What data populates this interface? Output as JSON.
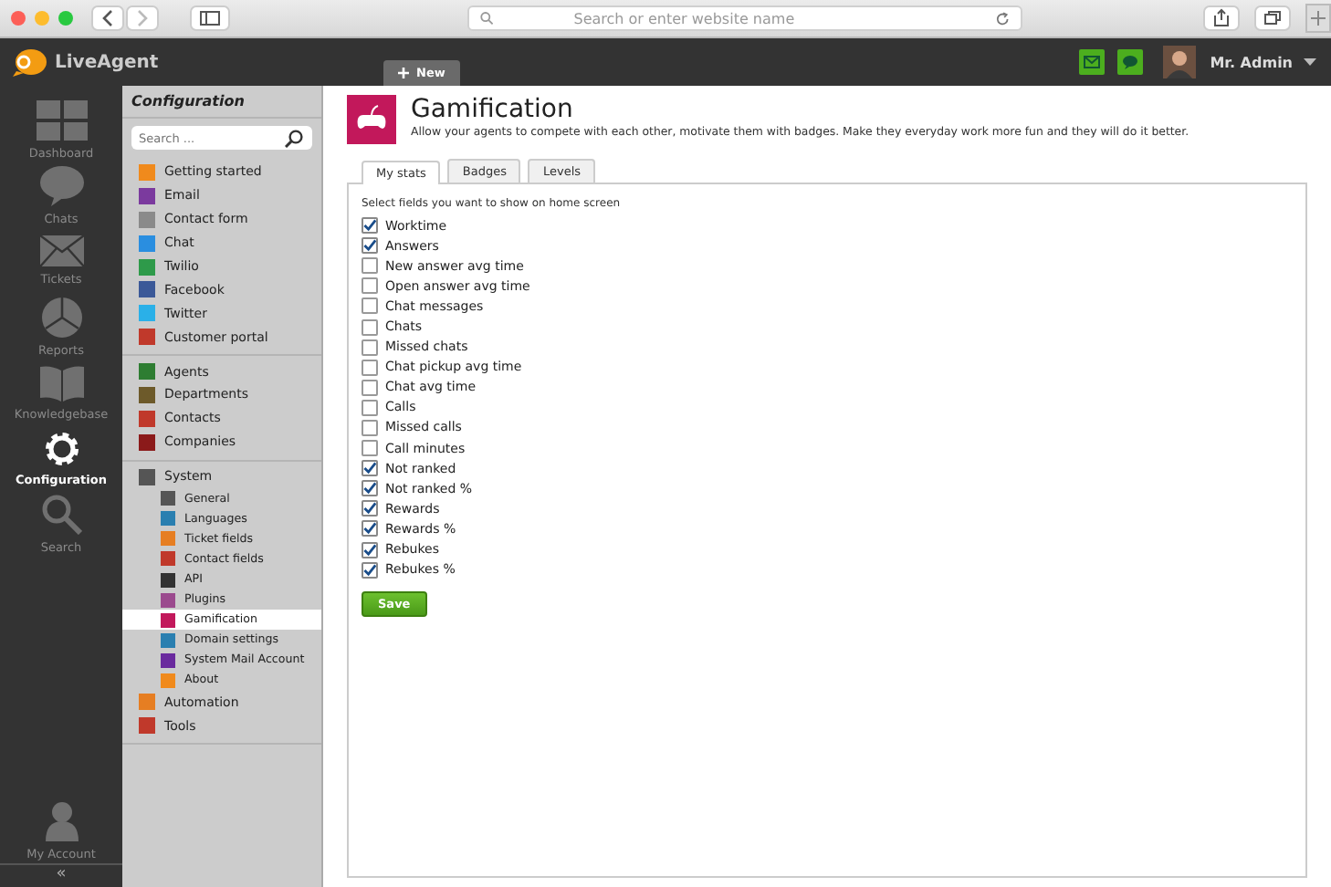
{
  "browser": {
    "address_placeholder": "Search or enter website name"
  },
  "app": {
    "logo": "LiveAgent",
    "new_tab": "New",
    "user": "Mr. Admin"
  },
  "nav": {
    "items": [
      {
        "label": "Dashboard",
        "kind": "dashboard",
        "selected": false
      },
      {
        "label": "Chats",
        "kind": "chats",
        "selected": false
      },
      {
        "label": "Tickets",
        "kind": "tickets",
        "selected": false
      },
      {
        "label": "Reports",
        "kind": "reports",
        "selected": false
      },
      {
        "label": "Knowledgebase",
        "kind": "knowledgebase",
        "selected": false
      },
      {
        "label": "Configuration",
        "kind": "configuration",
        "selected": true
      },
      {
        "label": "Search",
        "kind": "search",
        "selected": false
      }
    ],
    "account": "My Account",
    "collapse": "«"
  },
  "config": {
    "title": "Configuration",
    "search_placeholder": "Search ...",
    "groups": [
      {
        "items": [
          {
            "label": "Getting started",
            "color": "#f08a1c",
            "selected": false
          },
          {
            "label": "Email",
            "color": "#7b3a9e",
            "selected": false
          },
          {
            "label": "Contact form",
            "color": "#8a8a8a",
            "selected": false
          },
          {
            "label": "Chat",
            "color": "#2a8ee0",
            "selected": false
          },
          {
            "label": "Twilio",
            "color": "#2e9a4a",
            "selected": false
          },
          {
            "label": "Facebook",
            "color": "#3b5998",
            "selected": false
          },
          {
            "label": "Twitter",
            "color": "#2ab0e8",
            "selected": false
          },
          {
            "label": "Customer portal",
            "color": "#c0392b",
            "selected": false
          }
        ]
      },
      {
        "items": [
          {
            "label": "Agents",
            "color": "#2e7d32",
            "selected": false
          },
          {
            "label": "Departments",
            "color": "#6d5a2a",
            "selected": false
          },
          {
            "label": "Contacts",
            "color": "#c0392b",
            "selected": false
          },
          {
            "label": "Companies",
            "color": "#8b1a1a",
            "selected": false
          }
        ]
      },
      {
        "items": [
          {
            "label": "System",
            "color": "#555555",
            "selected": false,
            "children": [
              {
                "label": "General",
                "color": "#555555",
                "selected": false
              },
              {
                "label": "Languages",
                "color": "#2a7fb0",
                "selected": false
              },
              {
                "label": "Ticket fields",
                "color": "#e67e22",
                "selected": false
              },
              {
                "label": "Contact fields",
                "color": "#c0392b",
                "selected": false
              },
              {
                "label": "API",
                "color": "#333333",
                "selected": false
              },
              {
                "label": "Plugins",
                "color": "#9b4a8e",
                "selected": false
              },
              {
                "label": "Gamification",
                "color": "#c2185b",
                "selected": true
              },
              {
                "label": "Domain settings",
                "color": "#2a7fb0",
                "selected": false
              },
              {
                "label": "System Mail Account",
                "color": "#6a2a9e",
                "selected": false
              },
              {
                "label": "About",
                "color": "#f08a1c",
                "selected": false
              }
            ]
          },
          {
            "label": "Automation",
            "color": "#e67e22",
            "selected": false
          },
          {
            "label": "Tools",
            "color": "#c0392b",
            "selected": false
          }
        ]
      }
    ]
  },
  "content": {
    "title": "Gamification",
    "description": "Allow your agents to compete with each other, motivate them with badges. Make they everyday work more fun and they will do it better.",
    "tabs": [
      {
        "label": "My stats",
        "selected": true
      },
      {
        "label": "Badges",
        "selected": false
      },
      {
        "label": "Levels",
        "selected": false
      }
    ],
    "prompt": "Select fields you want to show on home screen",
    "fields": [
      {
        "label": "Worktime",
        "checked": true
      },
      {
        "label": "Answers",
        "checked": true
      },
      {
        "label": "New answer avg time",
        "checked": false
      },
      {
        "label": "Open answer avg time",
        "checked": false
      },
      {
        "label": "Chat messages",
        "checked": false
      },
      {
        "label": "Chats",
        "checked": false
      },
      {
        "label": "Missed chats",
        "checked": false
      },
      {
        "label": "Chat pickup avg time",
        "checked": false
      },
      {
        "label": "Chat avg time",
        "checked": false
      },
      {
        "label": "Calls",
        "checked": false
      },
      {
        "label": "Missed calls",
        "checked": false
      },
      {
        "label": "Call minutes",
        "checked": false
      },
      {
        "label": "Not ranked",
        "checked": true
      },
      {
        "label": "Not ranked %",
        "checked": true
      },
      {
        "label": "Rewards",
        "checked": true
      },
      {
        "label": "Rewards %",
        "checked": true
      },
      {
        "label": "Rebukes",
        "checked": true
      },
      {
        "label": "Rebukes %",
        "checked": true
      }
    ],
    "save": "Save"
  }
}
